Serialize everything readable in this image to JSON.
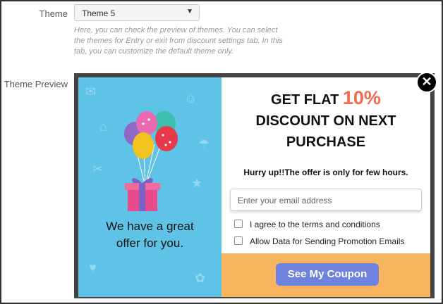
{
  "form": {
    "theme_label": "Theme",
    "theme_value": "Theme 5",
    "theme_help": "Here, you can check the preview of themes. You can select the themes for Entry or exit from discount settings tab. In this tab, you can customize the default theme only.",
    "preview_label": "Theme Preview"
  },
  "popup": {
    "left_text_line1": "We have a great",
    "left_text_line2": "offer for you.",
    "headline_prefix": "GET FLAT ",
    "headline_percent": "10%",
    "headline_line2": "DISCOUNT ON NEXT",
    "headline_line3": "PURCHASE",
    "subline": "Hurry up!!The offer is only for few hours.",
    "email_placeholder": "Enter your email address",
    "checkbox1_label": "I agree to the terms and conditions",
    "checkbox2_label": "Allow Data for Sending Promotion Emails",
    "button_label": "See My Coupon",
    "close_symbol": "✕"
  },
  "colors": {
    "left_bg": "#5ec3e6",
    "percent": "#f26a50",
    "footer_bg": "#f6b55e",
    "button_bg": "#6e82de"
  },
  "icons": [
    "dropdown-arrow-icon",
    "close-icon",
    "balloons-icon",
    "gift-icon",
    "checkbox-icon"
  ]
}
